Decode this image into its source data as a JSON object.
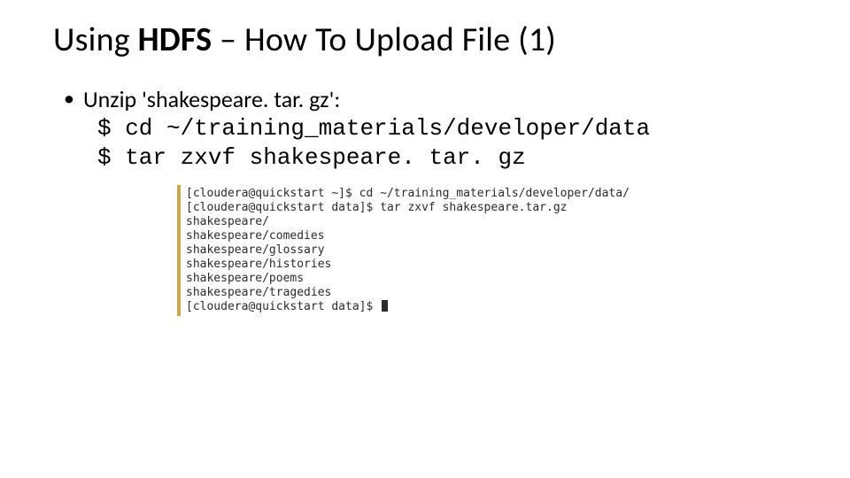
{
  "title": {
    "pre": "Using ",
    "bold": "HDFS",
    "post": " – How To Upload File (1)"
  },
  "bullet": {
    "text": "Unzip 'shakespeare. tar. gz':"
  },
  "commands": {
    "line1": "$ cd ~/training_materials/developer/data",
    "line2": "$ tar zxvf shakespeare. tar. gz"
  },
  "terminal": {
    "lines": [
      "[cloudera@quickstart ~]$ cd ~/training_materials/developer/data/",
      "[cloudera@quickstart data]$ tar zxvf shakespeare.tar.gz",
      "shakespeare/",
      "shakespeare/comedies",
      "shakespeare/glossary",
      "shakespeare/histories",
      "shakespeare/poems",
      "shakespeare/tragedies"
    ],
    "prompt": "[cloudera@quickstart data]$ "
  }
}
